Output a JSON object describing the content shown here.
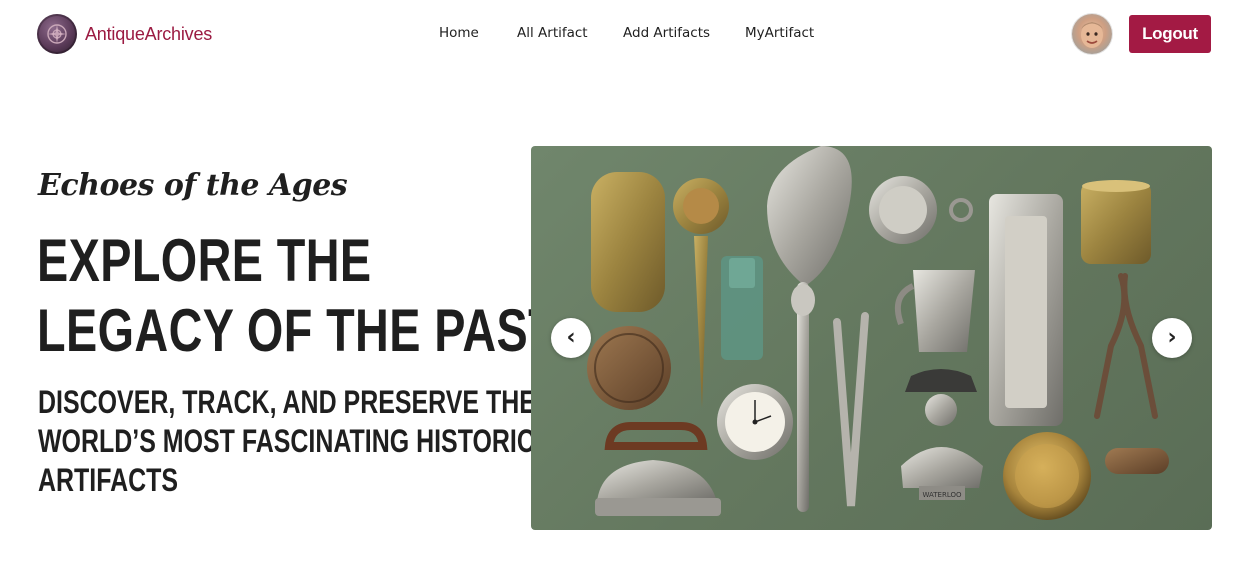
{
  "brand": {
    "name": "AntiqueArchives",
    "logo_icon": "compass-emblem-icon"
  },
  "nav": {
    "items": [
      {
        "label": "Home"
      },
      {
        "label": "All Artifact"
      },
      {
        "label": "Add Artifacts"
      },
      {
        "label": "MyArtifact"
      }
    ]
  },
  "user": {
    "avatar_icon": "user-avatar",
    "logout_label": "Logout"
  },
  "hero": {
    "tagline": "Echoes of the Ages",
    "headline_lines": [
      "EXPLORE THE",
      "LEGACY OF THE PAST"
    ],
    "subheadline_lines": [
      "DISCOVER, TRACK, AND PRESERVE THE",
      "WORLD’S MOST FASCINATING HISTORICAL",
      "ARTIFACTS"
    ]
  },
  "carousel": {
    "prev_icon": "chevron-left-icon",
    "next_icon": "chevron-right-icon",
    "prev_glyph": "‹",
    "next_glyph": "›",
    "slide_image": "antique-artifacts-flatlay",
    "bust_plaque_text": "WATERLOO"
  },
  "colors": {
    "accent": "#a31a44",
    "brand_text": "#9b1b42",
    "carousel_bg": "#6a7f66",
    "text": "#1f1f1f"
  }
}
